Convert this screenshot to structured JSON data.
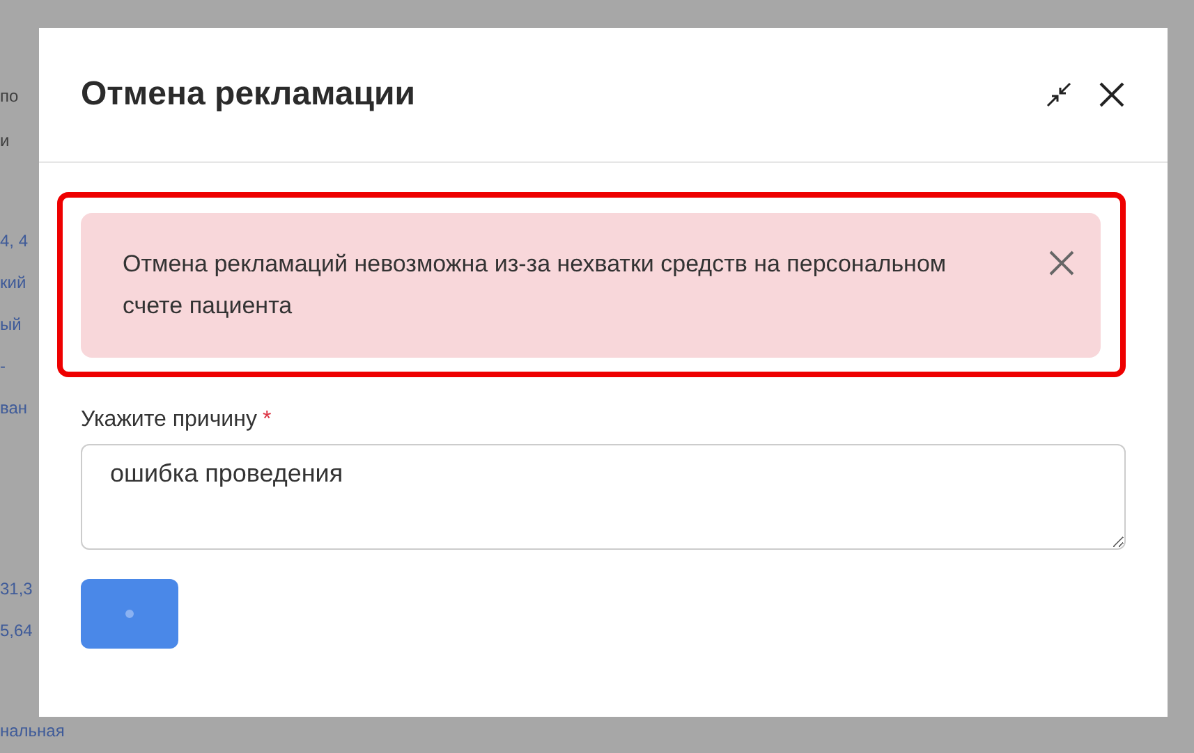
{
  "background": {
    "fragments": [
      {
        "text": "по",
        "kind": "plain"
      },
      {
        "text": "и",
        "kind": "plain"
      },
      {
        "text": "4, 4",
        "kind": "link"
      },
      {
        "text": "кий",
        "kind": "link"
      },
      {
        "text": "ый",
        "kind": "link"
      },
      {
        "text": "-",
        "kind": "link"
      },
      {
        "text": "ван",
        "kind": "link"
      },
      {
        "text": "31,3",
        "kind": "link"
      },
      {
        "text": "5,64",
        "kind": "link"
      },
      {
        "text": "нальная",
        "kind": "link"
      }
    ]
  },
  "dialog": {
    "title": "Отмена рекламации",
    "alert": {
      "text": "Отмена рекламаций невозможна из-за нехватки средств на персональном счете пациента",
      "highlighted": true
    },
    "reason": {
      "label": "Укажите причину",
      "required": true,
      "required_mark": "*",
      "value": "ошибка проведения"
    },
    "submit": {
      "loading": true
    }
  }
}
